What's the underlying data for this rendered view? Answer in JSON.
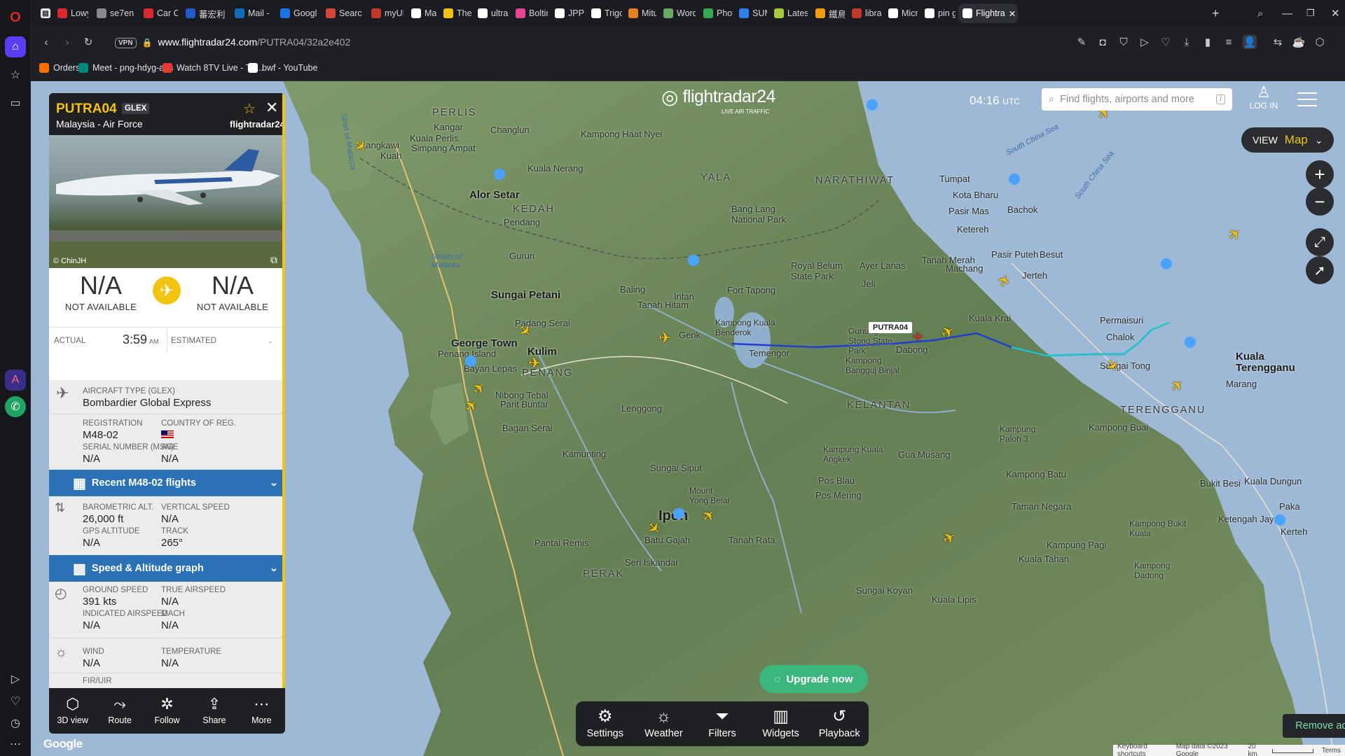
{
  "browser": {
    "tabs": [
      {
        "label": "Lowy",
        "icon": "hashtag",
        "color": "#d8292f"
      },
      {
        "label": "se7en",
        "icon": "clock",
        "color": "#8a8a8a"
      },
      {
        "label": "Car Cl",
        "icon": "hashtag",
        "color": "#d8292f"
      },
      {
        "label": "蕃宏利",
        "icon": "pen",
        "color": "#1e5cc8"
      },
      {
        "label": "Mail -",
        "icon": "outlook",
        "color": "#0f6cbd"
      },
      {
        "label": "Googl",
        "icon": "calendar",
        "color": "#1a73e8"
      },
      {
        "label": "Search",
        "icon": "gmail",
        "color": "#d44638"
      },
      {
        "label": "myUL",
        "icon": "circle",
        "color": "#c0392b"
      },
      {
        "label": "Malay",
        "icon": "doc",
        "color": "#ffffff"
      },
      {
        "label": "The Pr",
        "icon": "globe",
        "color": "#f1c40f"
      },
      {
        "label": "ultras",
        "icon": "google",
        "color": "#ffffff"
      },
      {
        "label": "Boltin",
        "icon": "dots",
        "color": "#e84393"
      },
      {
        "label": "JPP 20",
        "icon": "doc",
        "color": "#ffffff"
      },
      {
        "label": "Trigon",
        "icon": "doc",
        "color": "#ffffff"
      },
      {
        "label": "Mitutc",
        "icon": "M",
        "color": "#e67e22"
      },
      {
        "label": "Wordl",
        "icon": "grid",
        "color": "#6aaa64"
      },
      {
        "label": "Photo",
        "icon": "pinwheel",
        "color": "#34a853"
      },
      {
        "label": "SUMB",
        "icon": "triangle",
        "color": "#2f80ed"
      },
      {
        "label": "Latest",
        "icon": "leaf",
        "color": "#a3c93a"
      },
      {
        "label": "鐵鳥迷",
        "icon": "bird",
        "color": "#f39c12"
      },
      {
        "label": "library",
        "icon": "circle",
        "color": "#c0392b"
      },
      {
        "label": "Micro",
        "icon": "doc",
        "color": "#ffffff"
      },
      {
        "label": "pin go",
        "icon": "google",
        "color": "#ffffff"
      },
      {
        "label": "Flightra",
        "icon": "radar",
        "color": "#ffffff",
        "active": true
      }
    ],
    "url_host": "www.flightradar24.com",
    "url_path": "/PUTRA04/32a2e402",
    "vpn_label": "VPN",
    "bookmarks": [
      {
        "label": "Orders",
        "icon": "shop",
        "color": "#ff6d00"
      },
      {
        "label": "Meet - png-hdyg-aqs",
        "icon": "meet",
        "color": "#00897b"
      },
      {
        "label": "Watch 8TV Live - TV...",
        "icon": "tv",
        "color": "#e53935"
      },
      {
        "label": "bwf - YouTube",
        "icon": "doc",
        "color": "#ffffff"
      }
    ]
  },
  "fr24": {
    "logo_text": "flightradar24",
    "logo_sub": "LIVE AIR TRAFFIC",
    "time": "04:16",
    "time_zone": "UTC",
    "search_placeholder": "Find flights, airports and more",
    "search_shortcut": "/",
    "login_label": "LOG IN",
    "view_label": "VIEW",
    "view_value": "Map",
    "upgrade_label": "Upgrade now",
    "remove_ads_label": "Remove ads",
    "bottom_bar": [
      "Settings",
      "Weather",
      "Filters",
      "Widgets",
      "Playback"
    ],
    "attribution": [
      "Keyboard shortcuts",
      "Map data ©2023 Google",
      "20 km",
      "Terms"
    ],
    "google_mark": "Google"
  },
  "flight": {
    "callsign": "PUTRA04",
    "type_badge": "GLEX",
    "airline": "Malaysia - Air Force",
    "photo_credit": "© ChinJH",
    "panel_brand": "flightradar24",
    "origin_code": "N/A",
    "origin_name": "NOT AVAILABLE",
    "dest_code": "N/A",
    "dest_name": "NOT AVAILABLE",
    "actual_label": "ACTUAL",
    "actual_time": "3:59",
    "actual_ampm": "AM",
    "estimated_label": "ESTIMATED",
    "estimated_time": "-",
    "aircraft_type_label": "AIRCRAFT TYPE (GLEX)",
    "aircraft_type": "Bombardier Global Express",
    "registration_label": "REGISTRATION",
    "registration": "M48-02",
    "country_label": "COUNTRY OF REG.",
    "serial_label": "SERIAL NUMBER (MSN)",
    "serial": "N/A",
    "age_label": "AGE",
    "age": "N/A",
    "recent_flights_label": "Recent M48-02 flights",
    "baro_alt_label": "BAROMETRIC ALT.",
    "baro_alt": "26,000 ft",
    "vert_speed_label": "VERTICAL SPEED",
    "vert_speed": "N/A",
    "gps_alt_label": "GPS ALTITUDE",
    "gps_alt": "N/A",
    "track_label": "TRACK",
    "track": "265°",
    "speed_graph_label": "Speed & Altitude graph",
    "ground_speed_label": "GROUND SPEED",
    "ground_speed": "391 kts",
    "true_airspeed_label": "TRUE AIRSPEED",
    "true_airspeed": "N/A",
    "ias_label": "INDICATED AIRSPEED",
    "ias": "N/A",
    "mach_label": "MACH",
    "mach": "N/A",
    "wind_label": "WIND",
    "wind": "N/A",
    "temp_label": "TEMPERATURE",
    "temp": "N/A",
    "fir_label": "FIR/UIR",
    "toolbar": [
      "3D view",
      "Route",
      "Follow",
      "Share",
      "More"
    ]
  },
  "map_labels": {
    "regions": [
      "PERLIS",
      "KEDAH",
      "YALA",
      "NARATHIWAT",
      "PENANG",
      "KELANTAN",
      "TERENGGANU",
      "PERAK"
    ],
    "cities": [
      "Alor Setar",
      "Sungai Petani",
      "George Town",
      "Kulim",
      "Ipoh",
      "Kuala Terengganu"
    ],
    "towns": [
      "Langkawi",
      "Kuah",
      "Kuala Perlis",
      "Kangar",
      "Changlun",
      "Simpang Ampat",
      "Kuala Nerang",
      "Kampong Haat Nyei",
      "Pendang",
      "Gurun",
      "Baling",
      "Intan",
      "Tanah Hitam",
      "Padang Serai",
      "Fort Tapong",
      "Royal Belum State Park",
      "Bang Lang National Park",
      "Tumpat",
      "Kota Bharu",
      "Pasir Mas",
      "Bachok",
      "Ketereh",
      "Pasir Puteh",
      "Besut",
      "Jeli",
      "Ayer Lanas",
      "Tanah Merah",
      "Machang",
      "Jerteh",
      "Permaisuri",
      "Kuala Krai",
      "Chalok",
      "Gunung Stong State Park",
      "Dabong",
      "Sungai Tong",
      "Marang",
      "Kampong Bangguj Binjal",
      "Temengor",
      "Kampong Kuala Benderok",
      "Gerik",
      "Lenggong",
      "Penang Island",
      "Bayan Lepas",
      "Nibong Tebal",
      "Parit Buntar",
      "Bagan Serai",
      "Kamunting",
      "Sungai Siput",
      "Pos Blau",
      "Kampung Kuala Angkek",
      "Gua Musang",
      "Kampung Paloh 3",
      "Kampong Buai",
      "Kampong Batu",
      "Bukit Besi",
      "Kuala Dungun",
      "Paka",
      "Ketengah Jaya",
      "Kerteh",
      "Kampong Bukit Kuala",
      "Kampung Pagi",
      "Kuala Tahan",
      "Taman Negara",
      "Kampong Dadong",
      "Kuala Lipis",
      "Sungai Koyan",
      "Tanah Rata",
      "Batu Gajah",
      "Seri Iskandar",
      "Pantai Remis",
      "Mount Yong Belar",
      "Straits of Malacca",
      "Strait of Malacca",
      "South China Sea",
      "Pos Mering"
    ],
    "flight_tag": "PUTRA04"
  }
}
